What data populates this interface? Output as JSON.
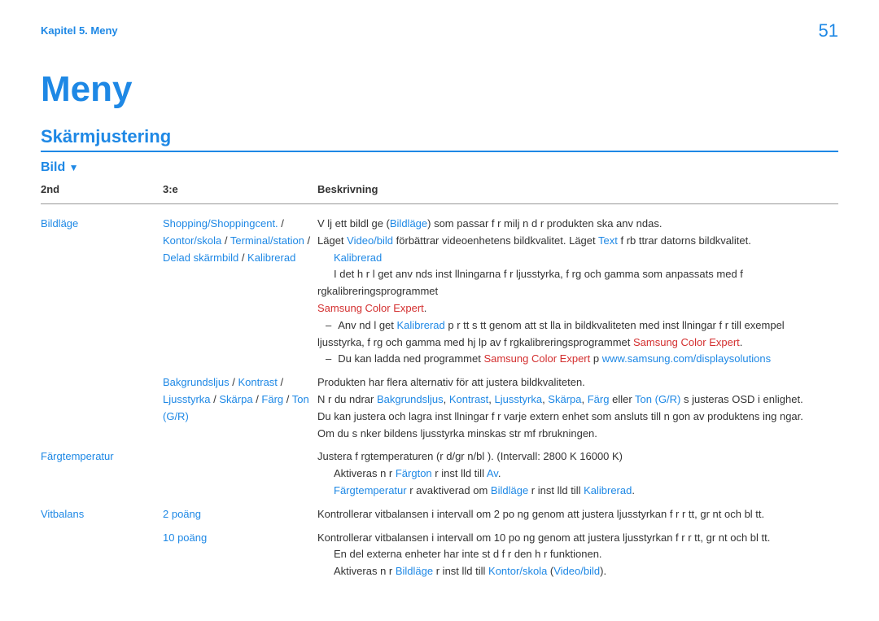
{
  "page_number": "51",
  "chapter": "Kapitel 5. Meny",
  "heading": "Meny",
  "section": "Skärmjustering",
  "subtitle": "Bild",
  "table": {
    "head": {
      "c1": "2nd",
      "c2": "3:e",
      "c3": "Beskrivning"
    },
    "row1": {
      "c1": "Bildläge",
      "c2_1": "Shopping/Shoppingcent.",
      "sep": " / ",
      "c2_2": "Kontor/skola",
      "c2_3": "Terminal/station",
      "c2_4": "Delad skärmbild",
      "c2_5": "Kalibrerad",
      "d1a": "V lj ett bildl ge (",
      "d1b": "Bildläge",
      "d1c": ") som passar f r milj n d r produkten ska anv ndas.",
      "d2a": "Läget ",
      "d2b": "Video/bild",
      "d2c": " förbättrar videoenhetens bildkvalitet. Läget ",
      "d2d": "Text",
      "d2e": " f rb ttrar datorns bildkvalitet.",
      "d3": "Kalibrerad",
      "d4a": "I det h r l get anv nds inst llningarna f r ljusstyrka, f rg och gamma som anpassats med f rgkalibreringsprogrammet ",
      "d4b": "Samsung Color Expert",
      "d4c": ".",
      "d5a": "Anv nd l get ",
      "d5b": "Kalibrerad",
      "d5c": " p  r tt s tt genom att st lla in bildkvaliteten med inst llningar f r till exempel ljusstyrka, f rg och gamma med hj lp av f rgkalibreringsprogrammet ",
      "d5d": "Samsung Color Expert",
      "d5e": ".",
      "d6a": "Du kan ladda ned programmet ",
      "d6b": "Samsung Color Expert",
      "d6c": " p  ",
      "d6d": "www.samsung.com/displaysolutions"
    },
    "row2": {
      "c1": "",
      "c2_1": "Bakgrundsljus",
      "sep": " / ",
      "c2_2": "Kontrast",
      "c2_3": "Ljusstyrka",
      "c2_4": "Skärpa",
      "c2_5": "Färg",
      "c2_6": "Ton (G/R)",
      "d1": "Produkten har flera alternativ för att justera bildkvaliteten.",
      "d2a": "N r du  ndrar ",
      "d2b": "Bakgrundsljus",
      "d2c": "Kontrast",
      "d2d": "Ljusstyrka",
      "d2e": "Skärpa",
      "d2f": "Färg",
      "d2g": " eller ",
      "d2h": "Ton (G/R)",
      "d2i": " s  justeras OSD i enlighet.",
      "d3": "Du kan justera och lagra inst llningar f r varje extern enhet som ansluts till n gon av produktens ing ngar.",
      "d4": "Om du s nker bildens ljusstyrka minskas str mf rbrukningen."
    },
    "row3": {
      "c1": "Färgtemperatur",
      "d1": "Justera f rgtemperaturen (r d/gr n/bl ). (Intervall: 2800 K 16000 K)",
      "d2a": "Aktiveras n r ",
      "d2b": "Färgton",
      "d2c": "  r inst lld till ",
      "d2d": "Av",
      "d2e": ".",
      "d3a": "Färgtemperatur",
      "d3b": "  r avaktiverad om ",
      "d3c": "Bildläge",
      "d3d": "  r inst lld till ",
      "d3e": "Kalibrerad",
      "d3f": "."
    },
    "row4": {
      "c1": "Vitbalans",
      "c2_1": "2 poäng",
      "d1": "Kontrollerar vitbalansen i intervall om 2 po ng genom att justera ljusstyrkan f r r tt, gr nt och bl tt."
    },
    "row5": {
      "c2_1": "10 poäng",
      "d1": "Kontrollerar vitbalansen i intervall om 10 po ng genom att justera ljusstyrkan f r r tt, gr nt och bl tt.",
      "d2": "En del externa enheter har inte st d f r den h r funktionen.",
      "d3a": "Aktiveras n r ",
      "d3b": "Bildläge",
      "d3c": "  r inst lld till ",
      "d3d": "Kontor/skola",
      "d3e": " (",
      "d3f": "Video/bild",
      "d3g": ")."
    }
  }
}
